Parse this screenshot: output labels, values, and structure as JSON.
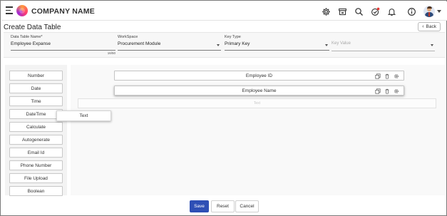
{
  "header": {
    "company_name": "COMPANY NAME",
    "icons": [
      "settings-icon",
      "storefront-icon",
      "search-icon",
      "task-check-icon",
      "bell-icon",
      "info-icon"
    ]
  },
  "page": {
    "title": "Create Data Table",
    "back_label": "Back"
  },
  "form": {
    "table_name": {
      "label": "Data Table Name*",
      "value": "Employee Expanse",
      "counter": "16/50"
    },
    "workspace": {
      "label": "WorkSpace",
      "value": "Procurement Module"
    },
    "key_type": {
      "label": "Key Type",
      "value": "Primary Key"
    },
    "key_value": {
      "placeholder": "Key Value"
    }
  },
  "sidebar": {
    "items": [
      "Number",
      "Date",
      "Time",
      "DateTime",
      "Calculate",
      "Autogenerate",
      "Email Id",
      "Phone Number",
      "File Upload",
      "Boolean"
    ]
  },
  "canvas": {
    "rows": [
      "Employee ID",
      "Employee Name"
    ],
    "drop_zone_label": "Text",
    "drag_ghost_label": "Text"
  },
  "footer": {
    "save_label": "Save",
    "reset_label": "Reset",
    "cancel_label": "Cancel"
  },
  "colors": {
    "primary_button": "#2e4fb5",
    "notification_badge": "#e53935"
  }
}
